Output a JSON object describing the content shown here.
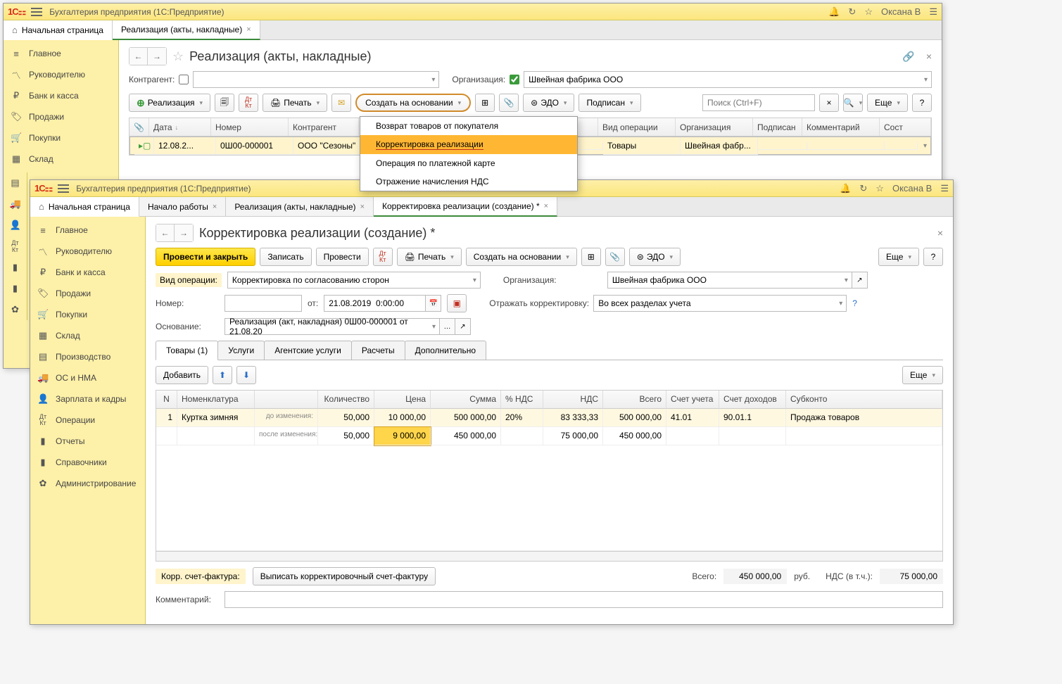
{
  "win1": {
    "title": "Бухгалтерия предприятия  (1С:Предприятие)",
    "user": "Оксана В",
    "tabs": {
      "home": "Начальная страница",
      "t1": "Реализация (акты, накладные)"
    },
    "nav": [
      "Главное",
      "Руководителю",
      "Банк и касса",
      "Продажи",
      "Покупки",
      "Склад"
    ],
    "page_title": "Реализация (акты, накладные)",
    "filters": {
      "counterparty_lbl": "Контрагент:",
      "org_lbl": "Организация:",
      "org_val": "Швейная фабрика ООО"
    },
    "toolbar": {
      "realize": "Реализация",
      "print": "Печать",
      "create_based": "Создать на основании",
      "edo": "ЭДО",
      "signed": "Подписан",
      "search_ph": "Поиск (Ctrl+F)",
      "more": "Еще"
    },
    "dropdown": [
      "Возврат товаров от покупателя",
      "Корректировка реализации",
      "Операция по платежной карте",
      "Отражение начисления НДС"
    ],
    "grid": {
      "cols": [
        "",
        "Дата",
        "Номер",
        "Контрагент",
        "",
        "Вид операции",
        "Организация",
        "Подписан",
        "Комментарий",
        "Сост"
      ],
      "row": {
        "date": "12.08.2...",
        "num": "0Ш00-000001",
        "ctr": "ООО \"Сезоны\"",
        "op": "Товары",
        "org": "Швейная фабр..."
      }
    }
  },
  "win2": {
    "title": "Бухгалтерия предприятия  (1С:Предприятие)",
    "user": "Оксана В",
    "tabs": {
      "home": "Начальная страница",
      "t1": "Начало работы",
      "t2": "Реализация (акты, накладные)",
      "t3": "Корректировка реализации (создание) *"
    },
    "nav": [
      "Главное",
      "Руководителю",
      "Банк и касса",
      "Продажи",
      "Покупки",
      "Склад",
      "Производство",
      "ОС и НМА",
      "Зарплата и кадры",
      "Операции",
      "Отчеты",
      "Справочники",
      "Администрирование"
    ],
    "page_title": "Корректировка реализации (создание) *",
    "toolbar": {
      "post_close": "Провести и закрыть",
      "save": "Записать",
      "post": "Провести",
      "print": "Печать",
      "create_based": "Создать на основании",
      "edo": "ЭДО",
      "more": "Еще"
    },
    "form": {
      "op_type_lbl": "Вид операции:",
      "op_type_val": "Корректировка по согласованию сторон",
      "org_lbl": "Организация:",
      "org_val": "Швейная фабрика ООО",
      "num_lbl": "Номер:",
      "date_lbl": "от:",
      "date_val": "21.08.2019  0:00:00",
      "reflect_lbl": "Отражать корректировку:",
      "reflect_val": "Во всех разделах учета",
      "basis_lbl": "Основание:",
      "basis_val": "Реализация (акт, накладная) 0Ш00-000001 от 21.08.20"
    },
    "subtabs": [
      "Товары (1)",
      "Услуги",
      "Агентские услуги",
      "Расчеты",
      "Дополнительно"
    ],
    "toolbar2": {
      "add": "Добавить",
      "more": "Еще"
    },
    "items": {
      "cols": [
        "N",
        "Номенклатура",
        "",
        "Количество",
        "Цена",
        "Сумма",
        "% НДС",
        "НДС",
        "Всего",
        "Счет учета",
        "Счет доходов",
        "Субконто"
      ],
      "before_lbl": "до изменения:",
      "after_lbl": "после изменения:",
      "row_n": "1",
      "row_name": "Куртка зимняя",
      "before": {
        "qty": "50,000",
        "price": "10 000,00",
        "sum": "500 000,00",
        "vat_rate": "20%",
        "vat": "83 333,33",
        "total": "500 000,00",
        "acc": "41.01",
        "inc": "90.01.1",
        "sub": "Продажа товаров"
      },
      "after": {
        "qty": "50,000",
        "price": "9 000,00",
        "sum": "450 000,00",
        "vat_rate": "",
        "vat": "75 000,00",
        "total": "450 000,00",
        "acc": "",
        "inc": "",
        "sub": ""
      }
    },
    "footer": {
      "invoice_lbl": "Корр. счет-фактура:",
      "invoice_btn": "Выписать корректировочный счет-фактуру",
      "total_lbl": "Всего:",
      "total_val": "450 000,00",
      "cur": "руб.",
      "vat_lbl": "НДС (в т.ч.):",
      "vat_val": "75 000,00",
      "comment_lbl": "Комментарий:"
    }
  }
}
